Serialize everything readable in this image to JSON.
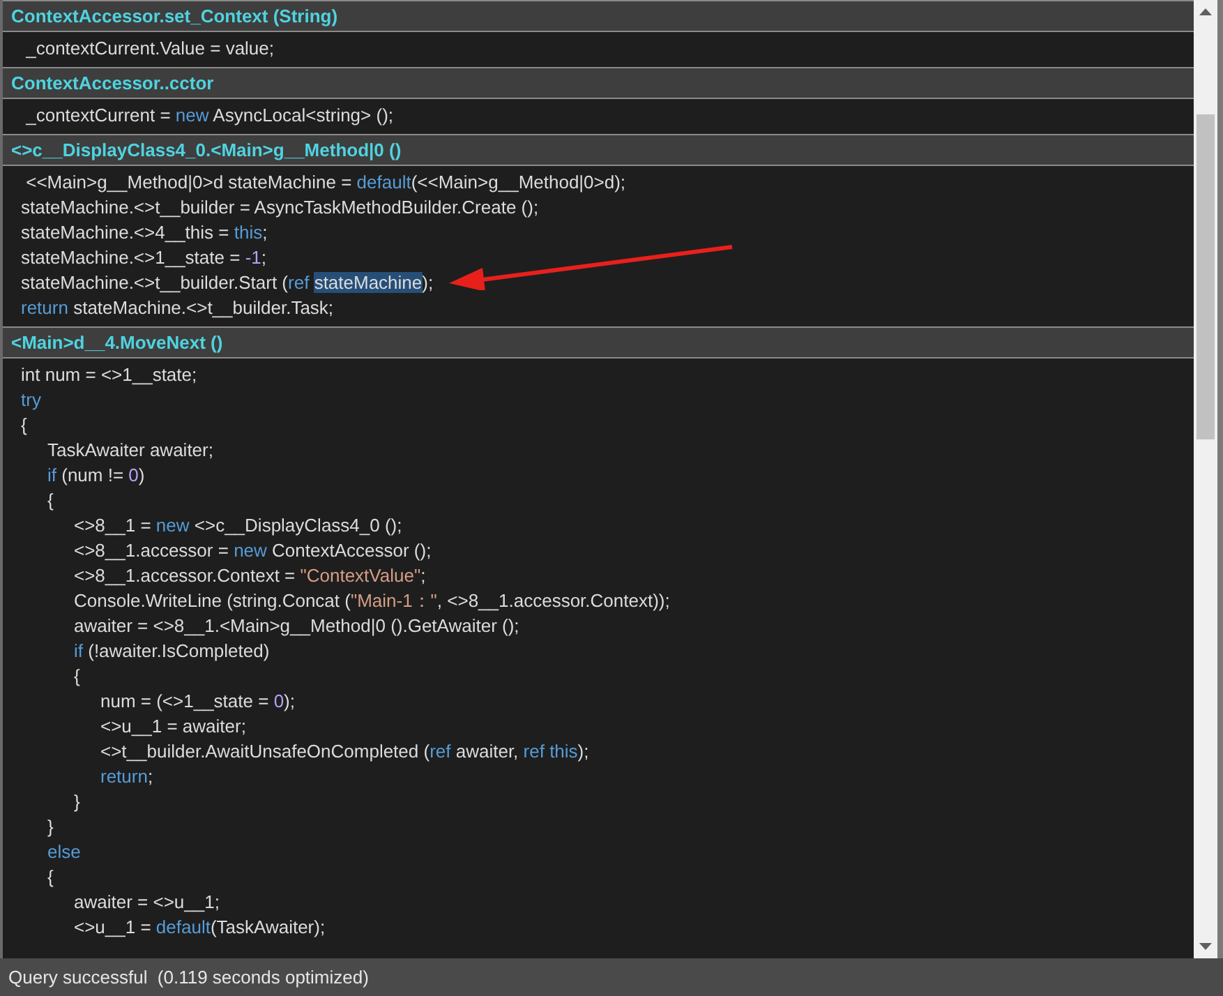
{
  "sections": [
    {
      "header": "ContextAccessor.set_Context (String)",
      "lines": [
        {
          "segments": [
            {
              "text": " _contextCurrent.Value = value;",
              "kind": "plain"
            }
          ]
        }
      ]
    },
    {
      "header": "ContextAccessor..cctor",
      "lines": [
        {
          "segments": [
            {
              "text": " _contextCurrent = ",
              "kind": "plain"
            },
            {
              "text": "new",
              "kind": "keyword"
            },
            {
              "text": " AsyncLocal<string> ();",
              "kind": "plain"
            }
          ]
        }
      ]
    },
    {
      "header": "<>c__DisplayClass4_0.<Main>g__Method|0 ()",
      "arrow": true,
      "lines": [
        {
          "segments": [
            {
              "text": " <<Main>g__Method|0>d stateMachine = ",
              "kind": "plain"
            },
            {
              "text": "default",
              "kind": "keyword"
            },
            {
              "text": "(<<Main>g__Method|0>d);",
              "kind": "plain"
            }
          ]
        },
        {
          "segments": [
            {
              "text": "stateMachine.<>t__builder = AsyncTaskMethodBuilder.Create ();",
              "kind": "plain"
            }
          ]
        },
        {
          "segments": [
            {
              "text": "stateMachine.<>4__this = ",
              "kind": "plain"
            },
            {
              "text": "this",
              "kind": "keyword"
            },
            {
              "text": ";",
              "kind": "plain"
            }
          ]
        },
        {
          "segments": [
            {
              "text": "stateMachine.<>1__state = ",
              "kind": "plain"
            },
            {
              "text": "-1",
              "kind": "number"
            },
            {
              "text": ";",
              "kind": "plain"
            }
          ]
        },
        {
          "segments": [
            {
              "text": "stateMachine.<>t__builder.Start (",
              "kind": "plain"
            },
            {
              "text": "ref ",
              "kind": "keyword"
            },
            {
              "text": "stateMachine",
              "kind": "selected"
            },
            {
              "text": ");",
              "kind": "plain"
            }
          ]
        },
        {
          "segments": [
            {
              "text": "return",
              "kind": "keyword"
            },
            {
              "text": " stateMachine.<>t__builder.Task;",
              "kind": "plain"
            }
          ]
        }
      ]
    },
    {
      "header": "<Main>d__4.MoveNext ()",
      "lines": [
        {
          "segments": [
            {
              "text": "int num = <>1__state;",
              "kind": "plain"
            }
          ]
        },
        {
          "segments": [
            {
              "text": "try",
              "kind": "keyword"
            }
          ]
        },
        {
          "segments": [
            {
              "text": "{",
              "kind": "plain"
            }
          ],
          "children": [
            {
              "segments": [
                {
                  "text": "TaskAwaiter awaiter;",
                  "kind": "plain"
                }
              ]
            },
            {
              "segments": [
                {
                  "text": "if",
                  "kind": "keyword"
                },
                {
                  "text": " (num != ",
                  "kind": "plain"
                },
                {
                  "text": "0",
                  "kind": "number"
                },
                {
                  "text": ")",
                  "kind": "plain"
                }
              ]
            },
            {
              "segments": [
                {
                  "text": "{",
                  "kind": "plain"
                }
              ],
              "children": [
                {
                  "segments": [
                    {
                      "text": "<>8__1 = ",
                      "kind": "plain"
                    },
                    {
                      "text": "new",
                      "kind": "keyword"
                    },
                    {
                      "text": " <>c__DisplayClass4_0 ();",
                      "kind": "plain"
                    }
                  ]
                },
                {
                  "segments": [
                    {
                      "text": "<>8__1.accessor = ",
                      "kind": "plain"
                    },
                    {
                      "text": "new",
                      "kind": "keyword"
                    },
                    {
                      "text": " ContextAccessor ();",
                      "kind": "plain"
                    }
                  ]
                },
                {
                  "segments": [
                    {
                      "text": "<>8__1.accessor.Context = ",
                      "kind": "plain"
                    },
                    {
                      "text": "\"ContextValue\"",
                      "kind": "string"
                    },
                    {
                      "text": ";",
                      "kind": "plain"
                    }
                  ]
                },
                {
                  "segments": [
                    {
                      "text": "Console.WriteLine (string.Concat (",
                      "kind": "plain"
                    },
                    {
                      "text": "\"Main-1：\"",
                      "kind": "string"
                    },
                    {
                      "text": ", <>8__1.accessor.Context));",
                      "kind": "plain"
                    }
                  ]
                },
                {
                  "segments": [
                    {
                      "text": "awaiter = <>8__1.<Main>g__Method|0 ().GetAwaiter ();",
                      "kind": "plain"
                    }
                  ]
                },
                {
                  "segments": [
                    {
                      "text": "if",
                      "kind": "keyword"
                    },
                    {
                      "text": " (!awaiter.IsCompleted)",
                      "kind": "plain"
                    }
                  ]
                },
                {
                  "segments": [
                    {
                      "text": "{",
                      "kind": "plain"
                    }
                  ],
                  "children": [
                    {
                      "segments": [
                        {
                          "text": "num = (<>1__state = ",
                          "kind": "plain"
                        },
                        {
                          "text": "0",
                          "kind": "number"
                        },
                        {
                          "text": ");",
                          "kind": "plain"
                        }
                      ]
                    },
                    {
                      "segments": [
                        {
                          "text": "<>u__1 = awaiter;",
                          "kind": "plain"
                        }
                      ]
                    },
                    {
                      "segments": [
                        {
                          "text": "<>t__builder.AwaitUnsafeOnCompleted (",
                          "kind": "plain"
                        },
                        {
                          "text": "ref",
                          "kind": "keyword"
                        },
                        {
                          "text": " awaiter, ",
                          "kind": "plain"
                        },
                        {
                          "text": "ref this",
                          "kind": "keyword"
                        },
                        {
                          "text": ");",
                          "kind": "plain"
                        }
                      ]
                    },
                    {
                      "segments": [
                        {
                          "text": "return",
                          "kind": "keyword"
                        },
                        {
                          "text": ";",
                          "kind": "plain"
                        }
                      ]
                    }
                  ]
                },
                {
                  "segments": [
                    {
                      "text": "}",
                      "kind": "plain"
                    }
                  ]
                }
              ]
            },
            {
              "segments": [
                {
                  "text": "}",
                  "kind": "plain"
                }
              ]
            },
            {
              "segments": [
                {
                  "text": "else",
                  "kind": "keyword"
                }
              ]
            },
            {
              "segments": [
                {
                  "text": "{",
                  "kind": "plain"
                }
              ],
              "children": [
                {
                  "segments": [
                    {
                      "text": "awaiter = <>u__1;",
                      "kind": "plain"
                    }
                  ]
                },
                {
                  "segments": [
                    {
                      "text": "<>u__1 = ",
                      "kind": "plain"
                    },
                    {
                      "text": "default",
                      "kind": "keyword"
                    },
                    {
                      "text": "(TaskAwaiter);",
                      "kind": "plain"
                    }
                  ]
                }
              ]
            }
          ]
        }
      ]
    }
  ],
  "status_bar": {
    "text": "Query successful  (0.119 seconds optimized)"
  }
}
